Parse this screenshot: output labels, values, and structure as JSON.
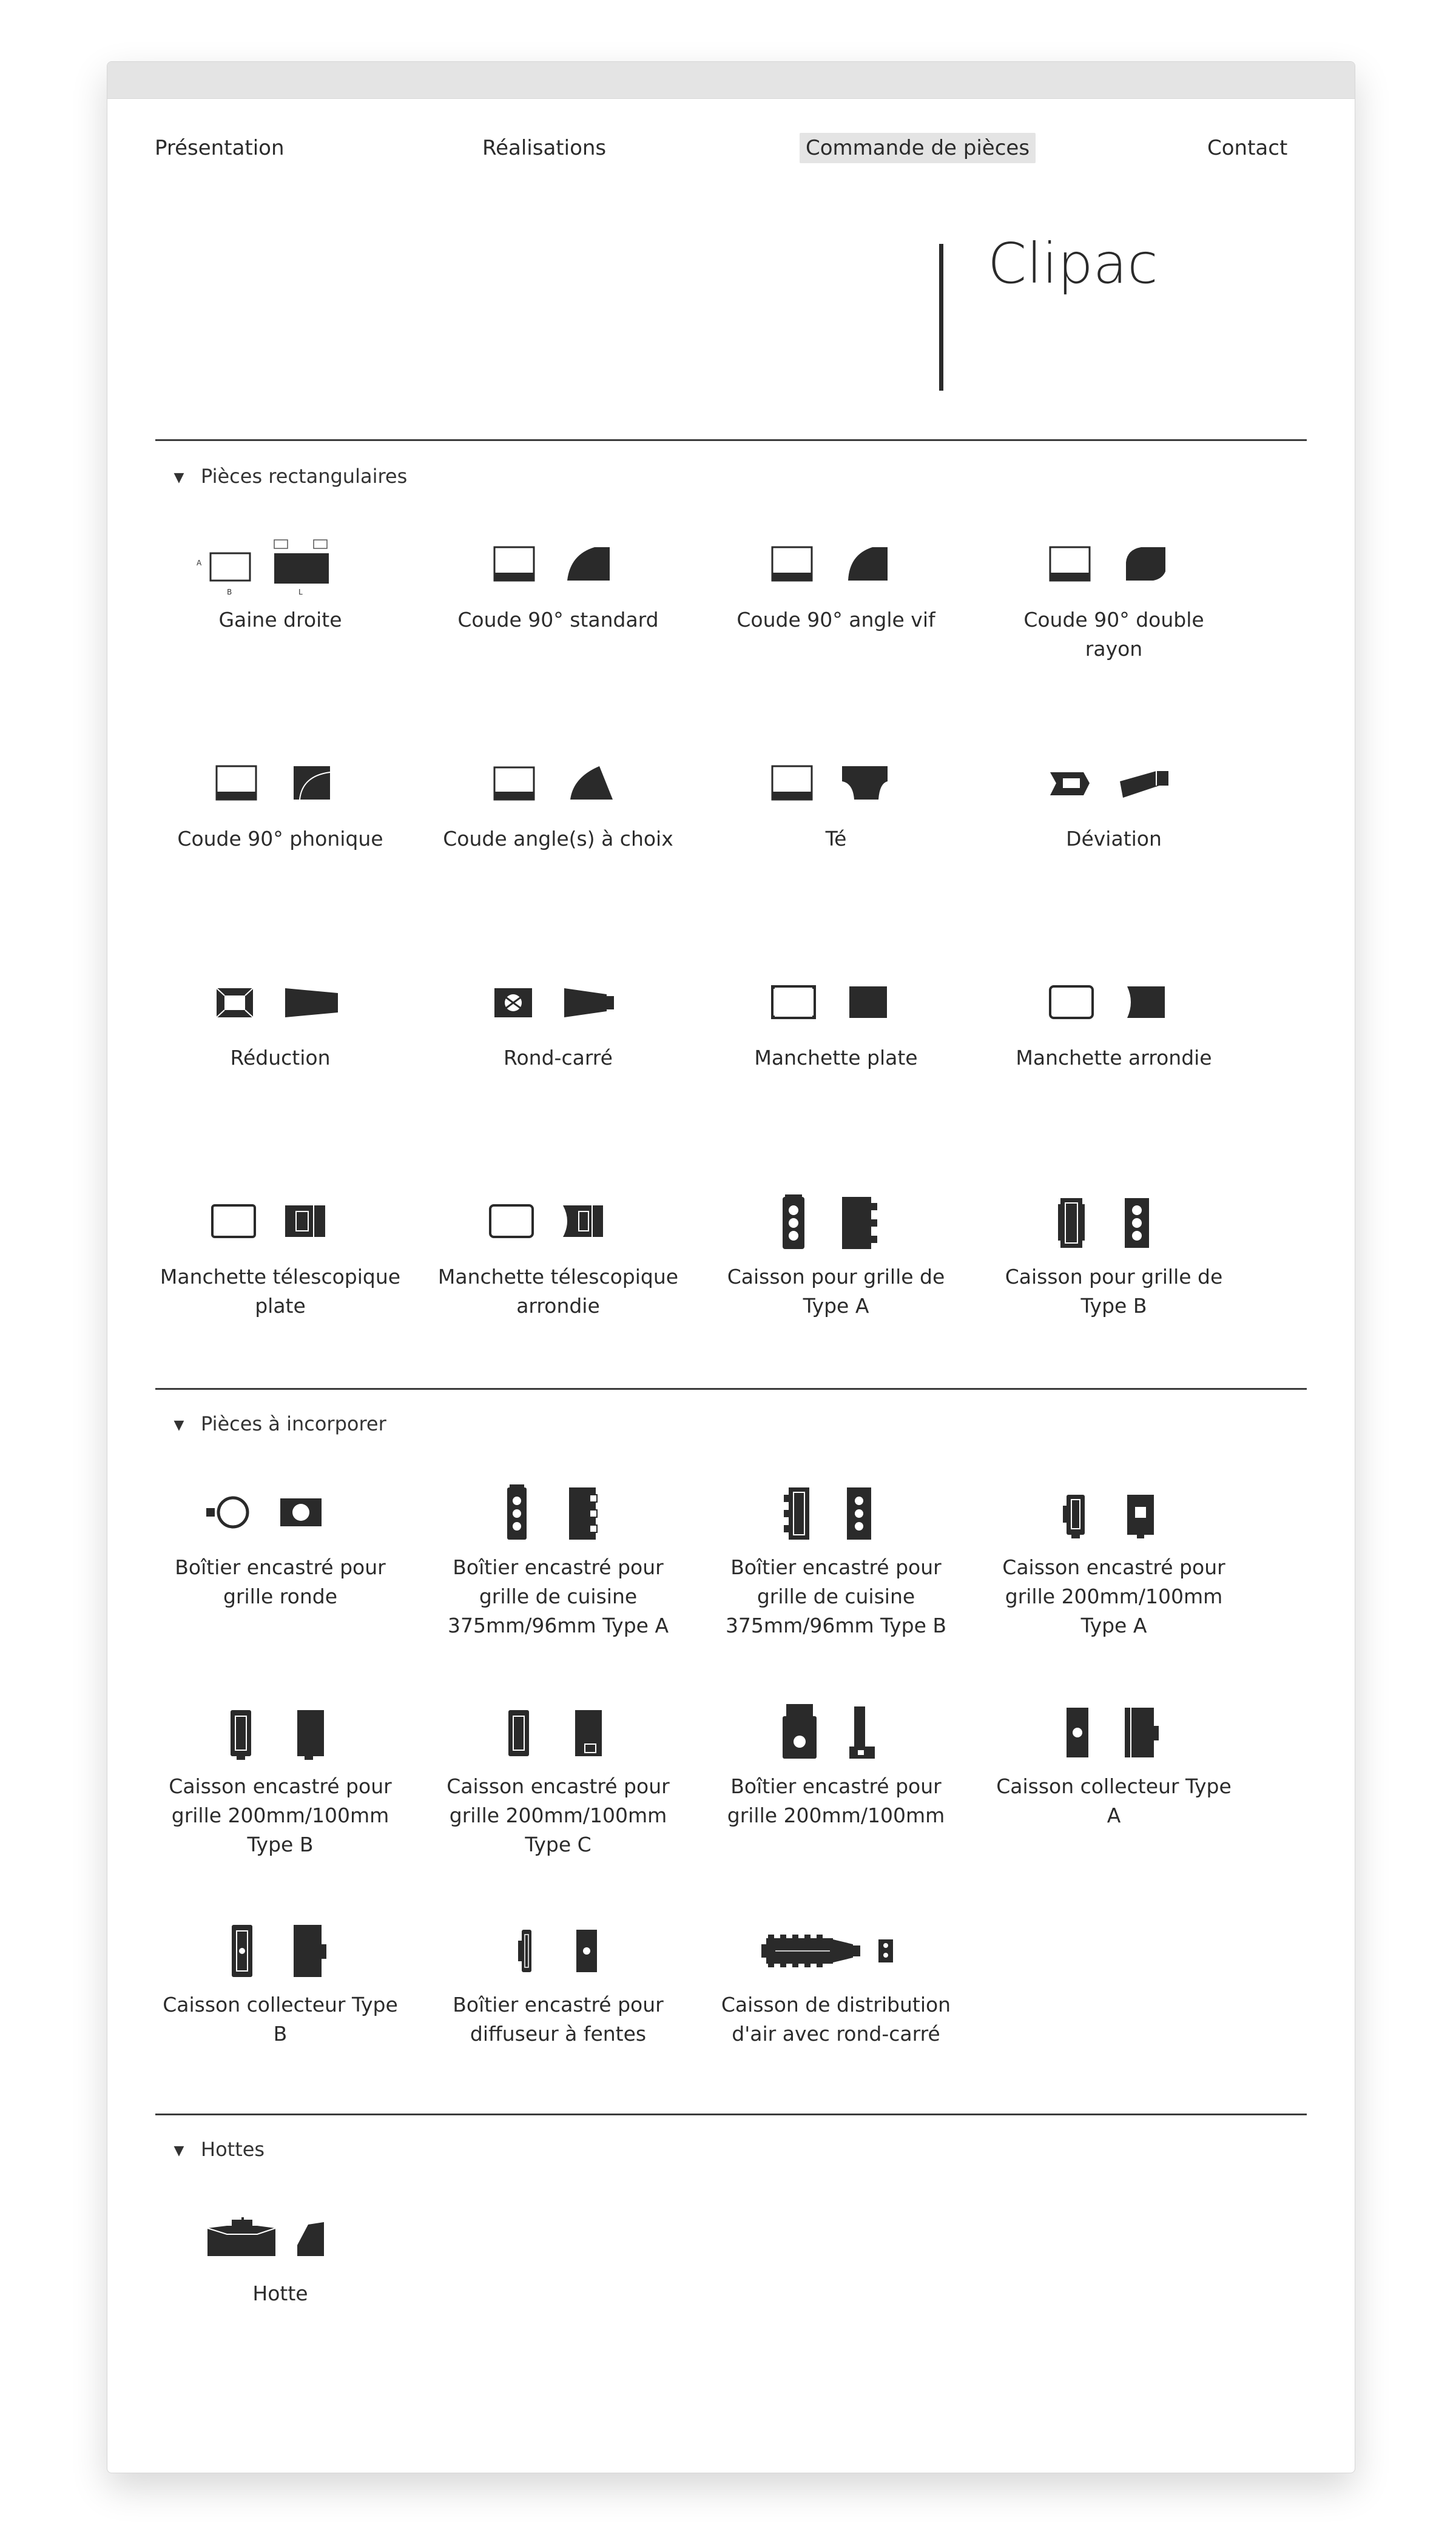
{
  "nav": [
    {
      "label": "Présentation"
    },
    {
      "label": "Réalisations"
    },
    {
      "label": "Commande de pièces"
    },
    {
      "label": "Contact"
    }
  ],
  "brand": {
    "title": "Clipac"
  },
  "sections": [
    {
      "title": "Pièces rectangulaires",
      "items": [
        {
          "caption": "Gaine droite",
          "icon": "straight-duct-icon"
        },
        {
          "caption": "Coude 90° standard",
          "icon": "elbow-standard-icon"
        },
        {
          "caption": "Coude 90° angle vif",
          "icon": "elbow-sharp-icon"
        },
        {
          "caption": "Coude 90° double rayon",
          "icon": "elbow-double-radius-icon"
        },
        {
          "caption": "Coude 90° phonique",
          "icon": "elbow-acoustic-icon"
        },
        {
          "caption": "Coude angle(s) à choix",
          "icon": "elbow-custom-angle-icon"
        },
        {
          "caption": "Té",
          "icon": "tee-icon"
        },
        {
          "caption": "Déviation",
          "icon": "offset-icon"
        },
        {
          "caption": "Réduction",
          "icon": "reducer-icon"
        },
        {
          "caption": "Rond-carré",
          "icon": "round-to-square-icon"
        },
        {
          "caption": "Manchette plate",
          "icon": "flat-collar-icon"
        },
        {
          "caption": "Manchette arrondie",
          "icon": "rounded-collar-icon"
        },
        {
          "caption": "Manchette télescopique plate",
          "icon": "telescopic-flat-collar-icon"
        },
        {
          "caption": "Manchette télescopique arrondie",
          "icon": "telescopic-rounded-collar-icon"
        },
        {
          "caption": "Caisson pour grille de Type A",
          "icon": "grille-box-a-icon"
        },
        {
          "caption": "Caisson pour grille de Type B",
          "icon": "grille-box-b-icon"
        }
      ]
    },
    {
      "title": "Pièces à incorporer",
      "items": [
        {
          "caption": "Boîtier encastré pour grille ronde",
          "icon": "round-grille-box-icon"
        },
        {
          "caption": "Boîtier encastré pour grille de cuisine 375mm/96mm Type A",
          "icon": "kitchen-grille-box-a-icon"
        },
        {
          "caption": "Boîtier encastré pour grille de cuisine 375mm/96mm Type B",
          "icon": "kitchen-grille-box-b-icon"
        },
        {
          "caption": "Caisson encastré pour grille 200mm/100mm Type A",
          "icon": "recessed-box-a-icon"
        },
        {
          "caption": "Caisson encastré pour grille 200mm/100mm Type B",
          "icon": "recessed-box-b-icon"
        },
        {
          "caption": "Caisson encastré pour grille 200mm/100mm Type C",
          "icon": "recessed-box-c-icon"
        },
        {
          "caption": "Boîtier encastré pour grille 200mm/100mm",
          "icon": "recessed-housing-icon"
        },
        {
          "caption": "Caisson collecteur Type A",
          "icon": "collector-box-a-icon"
        },
        {
          "caption": "Caisson collecteur Type B",
          "icon": "collector-box-b-icon"
        },
        {
          "caption": "Boîtier encastré pour diffuseur à fentes",
          "icon": "slot-diffuser-box-icon"
        },
        {
          "caption": "Caisson de distribution d'air avec rond-carré",
          "icon": "air-distribution-box-icon"
        }
      ]
    },
    {
      "title": "Hottes",
      "items": [
        {
          "caption": "Hotte",
          "icon": "hood-icon"
        }
      ]
    }
  ]
}
